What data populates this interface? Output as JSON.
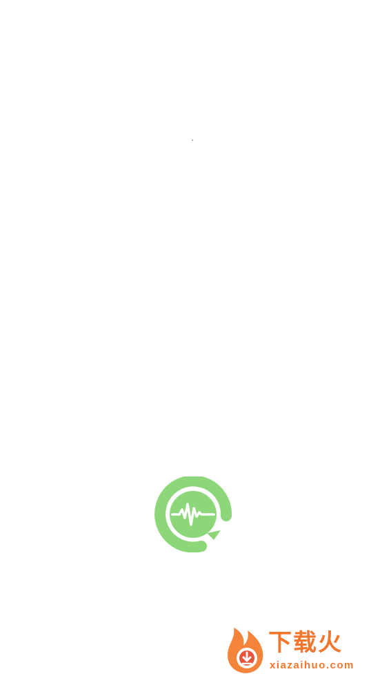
{
  "splash": {
    "logo_icon": "pulse-chat-bubble-icon",
    "logo_color": "#8dd67a",
    "background_color": "#ffffff"
  },
  "watermark": {
    "icon": "flame-download-icon",
    "title": "下载火",
    "url": "xiazaihuo.com",
    "color": "#f26b1d"
  }
}
